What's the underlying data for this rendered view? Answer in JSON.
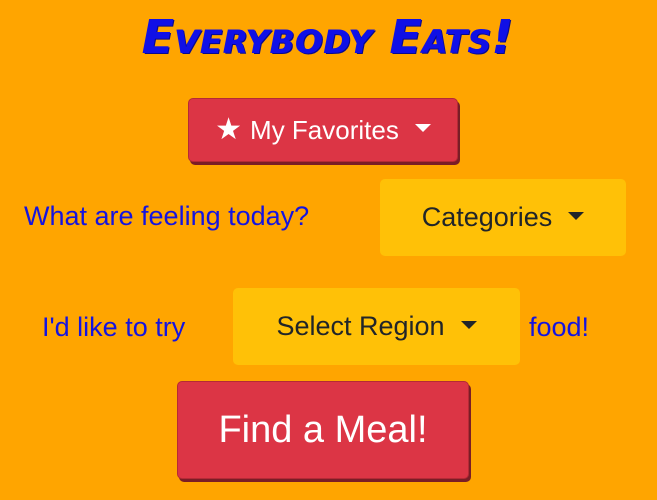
{
  "app": {
    "title": "Everybody Eats!"
  },
  "favorites_button": {
    "icon": "star-icon",
    "label": "My Favorites"
  },
  "mood_prompt": {
    "label": "What are feeling today?",
    "dropdown_label": "Categories"
  },
  "region_prompt": {
    "label_before": "I'd like to try",
    "dropdown_label": "Select Region",
    "label_after": "food!"
  },
  "find_button": {
    "label": "Find a Meal!"
  },
  "colors": {
    "background": "#ffa500",
    "title_blue": "#1010e6",
    "danger_red": "#dc3545",
    "warning_yellow": "#ffc107"
  }
}
